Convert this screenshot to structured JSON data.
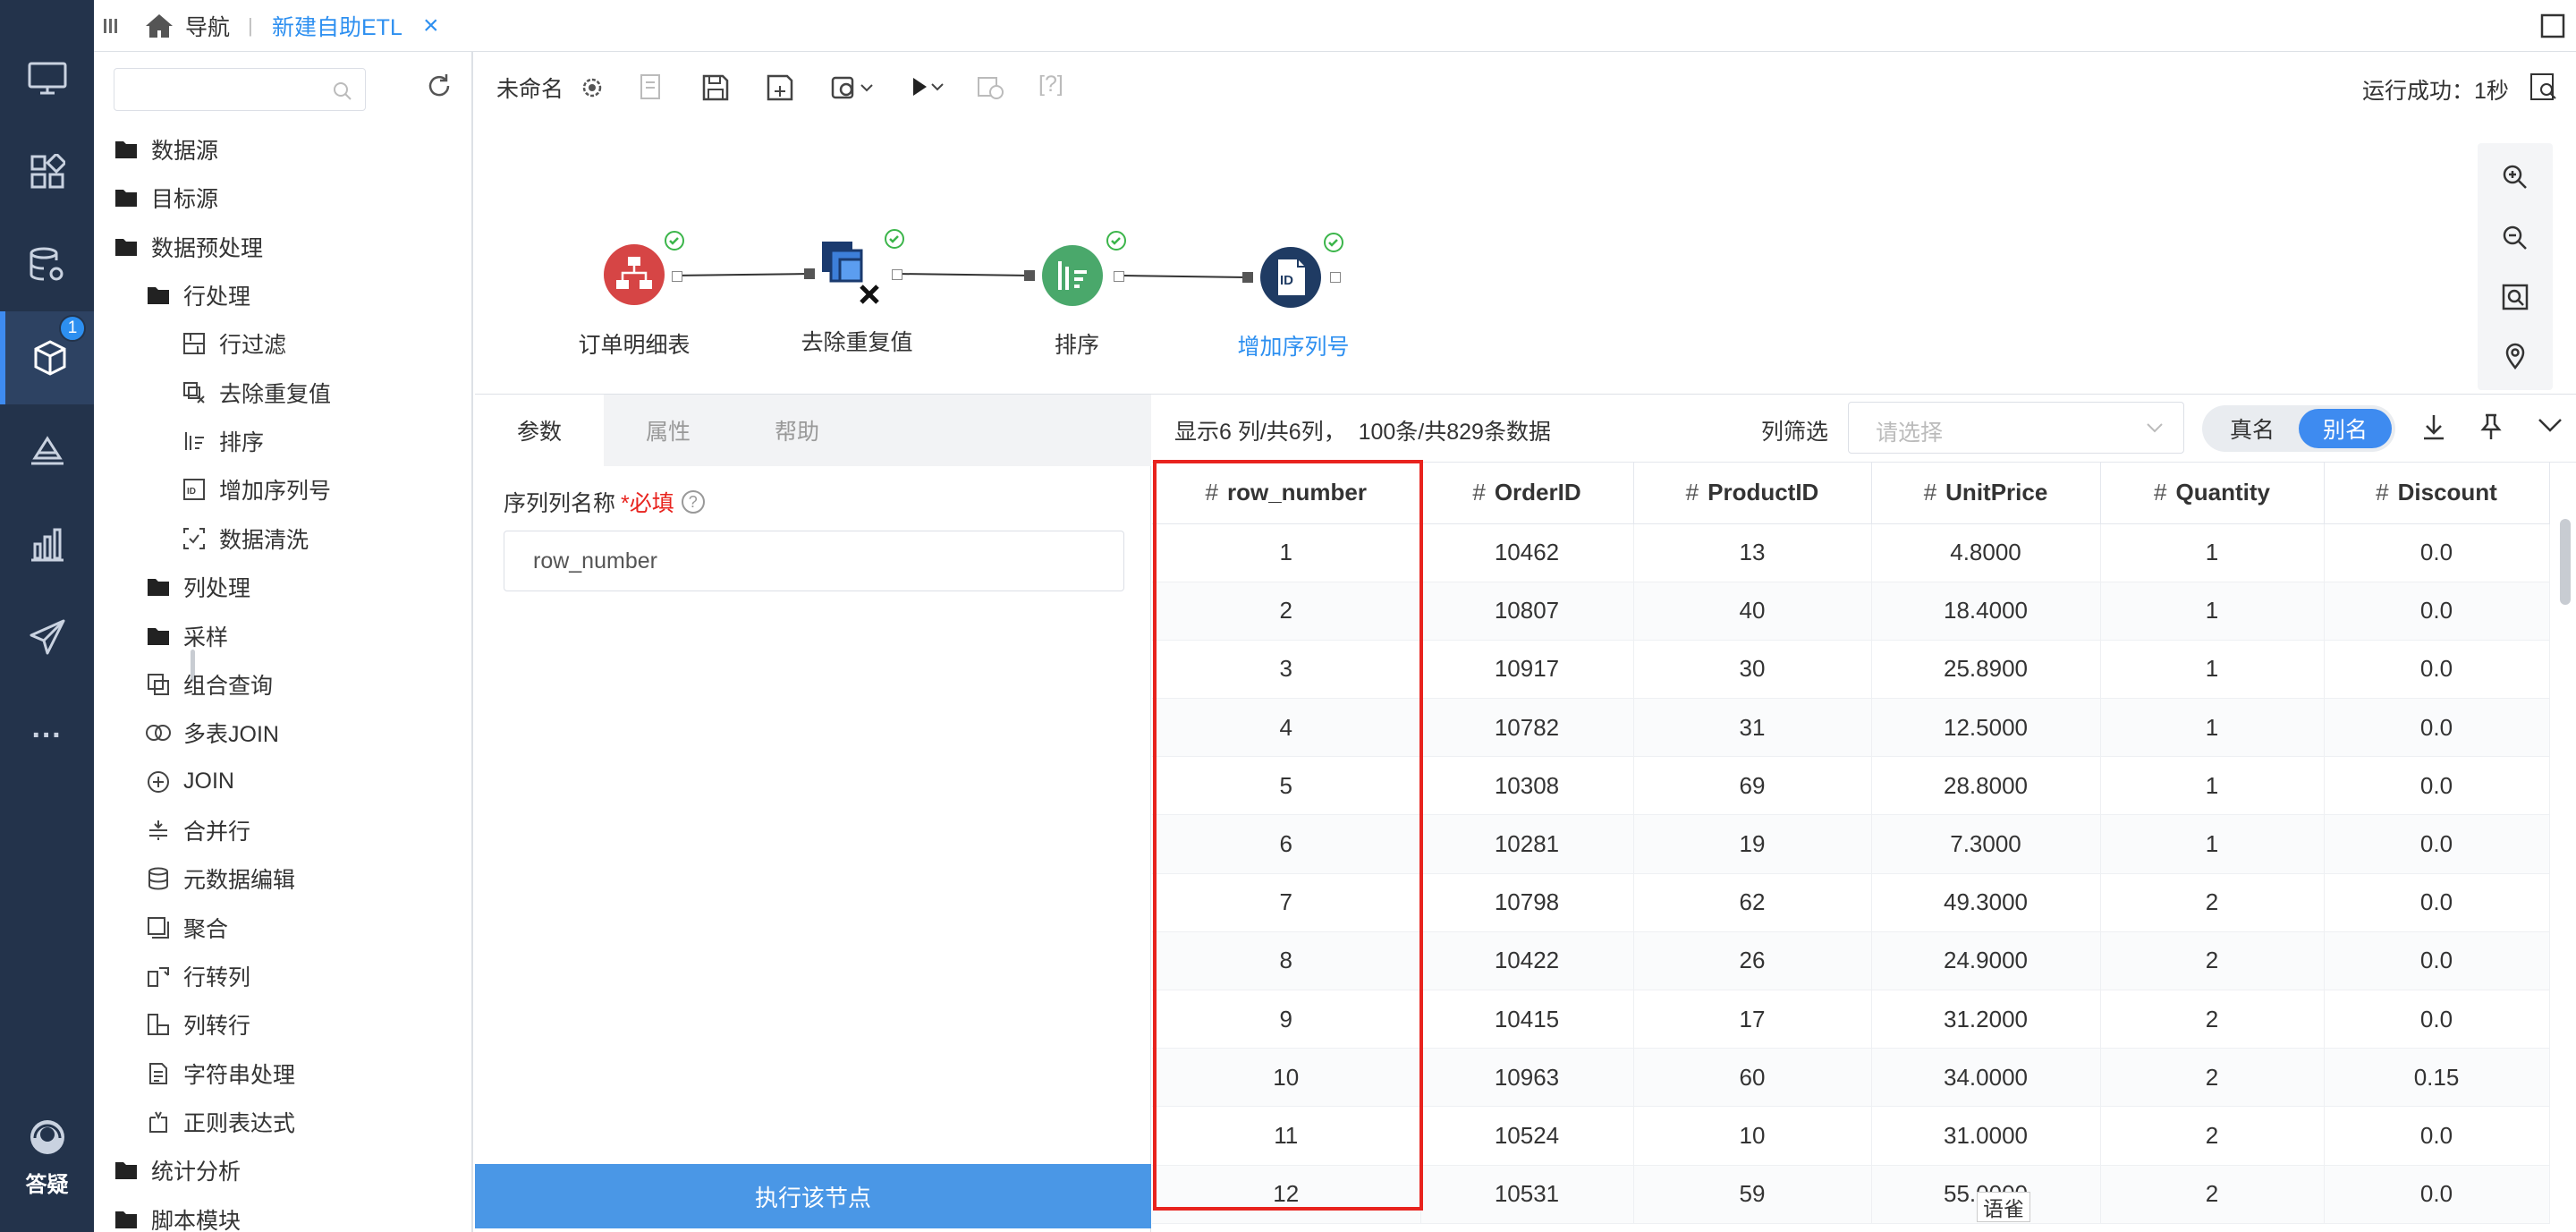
{
  "topbar": {
    "home_label": "导航",
    "separator": "|",
    "active_tab": "新建自助ETL",
    "close_glyph": "×"
  },
  "leftnav": {
    "badge": "1",
    "help_label": "答疑",
    "more_glyph": "···",
    "items": [
      "monitor-icon",
      "widgets-icon",
      "database-settings-icon",
      "etl-cube-icon",
      "dashboard-icon",
      "chart-icon",
      "send-icon",
      "more-icon"
    ]
  },
  "sidebar": {
    "items": [
      {
        "label": "数据源",
        "icon": "folder-icon"
      },
      {
        "label": "目标源",
        "icon": "folder-icon"
      },
      {
        "label": "数据预处理",
        "icon": "folder-open-icon"
      },
      {
        "label": "行处理",
        "icon": "folder-open-icon"
      },
      {
        "label": "行过滤",
        "icon": "row-filter-icon"
      },
      {
        "label": "去除重复值",
        "icon": "dedupe-icon"
      },
      {
        "label": "排序",
        "icon": "sort-icon"
      },
      {
        "label": "增加序列号",
        "icon": "serial-number-icon"
      },
      {
        "label": "数据清洗",
        "icon": "data-clean-icon"
      },
      {
        "label": "列处理",
        "icon": "folder-icon"
      },
      {
        "label": "采样",
        "icon": "folder-icon"
      },
      {
        "label": "组合查询",
        "icon": "combine-query-icon"
      },
      {
        "label": "多表JOIN",
        "icon": "multi-join-icon"
      },
      {
        "label": "JOIN",
        "icon": "join-icon"
      },
      {
        "label": "合并行",
        "icon": "merge-rows-icon"
      },
      {
        "label": "元数据编辑",
        "icon": "metadata-icon"
      },
      {
        "label": "聚合",
        "icon": "aggregate-icon"
      },
      {
        "label": "行转列",
        "icon": "row-to-col-icon"
      },
      {
        "label": "列转行",
        "icon": "col-to-row-icon"
      },
      {
        "label": "字符串处理",
        "icon": "string-icon"
      },
      {
        "label": "正则表达式",
        "icon": "regex-icon"
      },
      {
        "label": "统计分析",
        "icon": "folder-icon"
      },
      {
        "label": "脚本模块",
        "icon": "folder-icon"
      }
    ]
  },
  "toolbar": {
    "name": "未命名",
    "help_label": "[?]",
    "status": "运行成功：1秒"
  },
  "flow": {
    "nodes": [
      {
        "label": "订单明细表",
        "color": "#d64545"
      },
      {
        "label": "去除重复值",
        "color": "#3d7fd9"
      },
      {
        "label": "排序",
        "color": "#4aa86b"
      },
      {
        "label": "增加序列号",
        "color": "#1f3b63"
      }
    ]
  },
  "params": {
    "tabs": [
      "参数",
      "属性",
      "帮助"
    ],
    "field_label": "序列列名称",
    "required": "*必填",
    "help_icon": "?",
    "field_value": "row_number",
    "run_button": "执行该节点"
  },
  "datapanel": {
    "info": "显示6 列/共6列，  100条/共829条数据",
    "filter_label": "列筛选",
    "filter_placeholder": "请选择",
    "toggle_real": "真名",
    "toggle_alias": "别名"
  },
  "table": {
    "hash": "#",
    "columns": [
      "row_number",
      "OrderID",
      "ProductID",
      "UnitPrice",
      "Quantity",
      "Discount"
    ],
    "rows": [
      [
        "1",
        "10462",
        "13",
        "4.8000",
        "1",
        "0.0"
      ],
      [
        "2",
        "10807",
        "40",
        "18.4000",
        "1",
        "0.0"
      ],
      [
        "3",
        "10917",
        "30",
        "25.8900",
        "1",
        "0.0"
      ],
      [
        "4",
        "10782",
        "31",
        "12.5000",
        "1",
        "0.0"
      ],
      [
        "5",
        "10308",
        "69",
        "28.8000",
        "1",
        "0.0"
      ],
      [
        "6",
        "10281",
        "19",
        "7.3000",
        "1",
        "0.0"
      ],
      [
        "7",
        "10798",
        "62",
        "49.3000",
        "2",
        "0.0"
      ],
      [
        "8",
        "10422",
        "26",
        "24.9000",
        "2",
        "0.0"
      ],
      [
        "9",
        "10415",
        "17",
        "31.2000",
        "2",
        "0.0"
      ],
      [
        "10",
        "10963",
        "60",
        "34.0000",
        "2",
        "0.15"
      ],
      [
        "11",
        "10524",
        "10",
        "31.0000",
        "2",
        "0.0"
      ],
      [
        "12",
        "10531",
        "59",
        "55.0000",
        "2",
        "0.0"
      ]
    ]
  },
  "tooltip": "语雀",
  "colors": {
    "nav_bg": "#23334b",
    "accent": "#3e8bf0",
    "success": "#3bb54a",
    "highlight": "#e8231e",
    "run_button": "#4a97e6"
  }
}
